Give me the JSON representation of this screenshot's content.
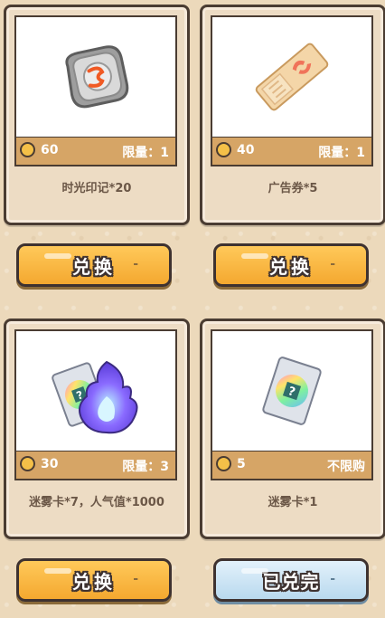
{
  "items": [
    {
      "price": "60",
      "limit": "限量：1",
      "name": "时光印记*20",
      "icon": "time-seal-icon"
    },
    {
      "price": "40",
      "limit": "限量：1",
      "name": "广告券*5",
      "icon": "ad-ticket-icon"
    },
    {
      "price": "30",
      "limit": "限量：3",
      "name": "迷雾卡*7，人气值*1000",
      "icon": "fog-card-flame-icon"
    },
    {
      "price": "5",
      "limit": "不限购",
      "name": "迷雾卡*1",
      "icon": "fog-card-icon"
    }
  ],
  "buttons": [
    {
      "label": "兑换",
      "state": "available",
      "color": "#f4a830"
    },
    {
      "label": "兑换",
      "state": "available",
      "color": "#f4a830"
    },
    {
      "label": "兑换",
      "state": "available",
      "color": "#f4a830"
    },
    {
      "label": "已兑完",
      "state": "sold-out",
      "color": "#b9d9ee"
    }
  ],
  "dash": "-"
}
